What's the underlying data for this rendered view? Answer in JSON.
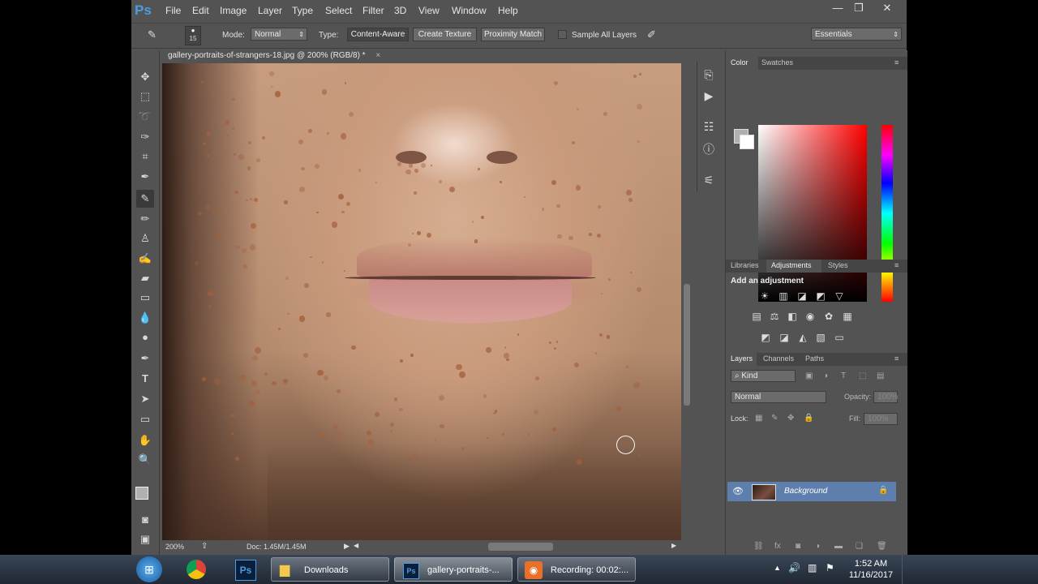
{
  "app": {
    "logo": "Ps",
    "menu": [
      "File",
      "Edit",
      "Image",
      "Layer",
      "Type",
      "Select",
      "Filter",
      "3D",
      "View",
      "Window",
      "Help"
    ],
    "window_controls": {
      "minimize": "—",
      "maximize": "❐",
      "close": "✕"
    }
  },
  "options_bar": {
    "brush_size": "15",
    "mode_label": "Mode:",
    "mode_value": "Normal",
    "type_label": "Type:",
    "type_buttons": [
      "Content-Aware",
      "Create Texture",
      "Proximity Match"
    ],
    "sample_all_layers": "Sample All Layers",
    "workspace": "Essentials"
  },
  "document": {
    "tab_title": "gallery-portraits-of-strangers-18.jpg @ 200% (RGB/8) *",
    "zoom": "200%",
    "doc_info": "Doc: 1.45M/1.45M"
  },
  "color_panel": {
    "tabs": [
      "Color",
      "Swatches"
    ],
    "fg_color": "#b0b0b0",
    "bg_color": "#ffffff"
  },
  "adjustments_panel": {
    "tabs": [
      "Libraries",
      "Adjustments",
      "Styles"
    ],
    "heading": "Add an adjustment"
  },
  "layers_panel": {
    "tabs": [
      "Layers",
      "Channels",
      "Paths"
    ],
    "filter_kind": "Kind",
    "blend_mode": "Normal",
    "opacity_label": "Opacity:",
    "opacity_value": "100%",
    "lock_label": "Lock:",
    "fill_label": "Fill:",
    "fill_value": "100%",
    "layers": [
      {
        "name": "Background",
        "visible": true,
        "locked": true
      }
    ]
  },
  "taskbar": {
    "items": [
      {
        "label": "Downloads",
        "icon": "folder-icon"
      },
      {
        "label": "gallery-portraits-...",
        "icon": "photoshop-icon"
      },
      {
        "label": "Recording: 00:02:...",
        "icon": "record-icon"
      }
    ],
    "time": "1:52 AM",
    "date": "11/16/2017"
  },
  "colors": {
    "ui_bg": "#535353",
    "accent_layer": "#5e7fae",
    "ps_blue": "#4d9be0"
  }
}
